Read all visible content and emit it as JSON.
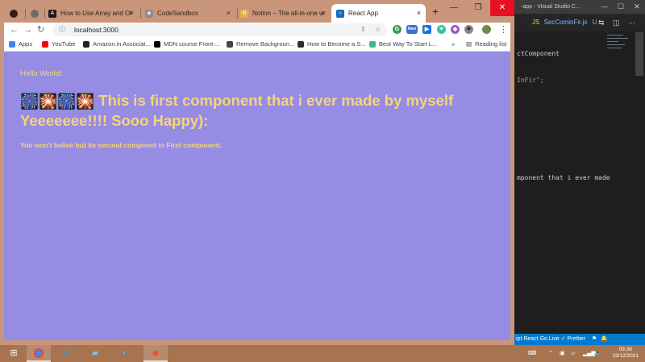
{
  "vscode": {
    "title": "-app - Visual Studio C...",
    "tab_file": "SecCominFir.js",
    "tab_status": "U",
    "code_lines": [
      "ctComponent",
      "InFir\";",
      "",
      "",
      "",
      "",
      "mponent that i ever made"
    ],
    "status_text": "ipt React   Go Live   ✓ Prettier"
  },
  "chrome": {
    "tabs": [
      {
        "label": "How to Use Array and Ol",
        "icon": "A",
        "color": "#1a1a1a"
      },
      {
        "label": "CodeSandbox",
        "icon": "◈",
        "color": "#6b6b6b"
      },
      {
        "label": "Notion – The all-in-one w",
        "icon": "N",
        "color": "#e0b24f"
      },
      {
        "label": "React App",
        "icon": "⚛",
        "color": "#1565c0"
      }
    ],
    "close_x": "×",
    "new_tab": "+",
    "url": "localhost:3000",
    "bookmarks": [
      {
        "label": "Apps",
        "color": "#4285f4"
      },
      {
        "label": "YouTube",
        "color": "#ff0000"
      },
      {
        "label": "Amazon.in Associat...",
        "color": "#222"
      },
      {
        "label": "MDN course Front-...",
        "color": "#000"
      },
      {
        "label": "Remove Backgroun...",
        "color": "#444"
      },
      {
        "label": "How to Become a S...",
        "color": "#2d2d2d"
      },
      {
        "label": "Best Way To Start L...",
        "color": "#41b883"
      }
    ],
    "more_bookmarks": "»",
    "reading_list": "Reading list",
    "extension_badge": "New"
  },
  "page": {
    "hello": "Hello World!",
    "emoji": "🎆🎇🎆🎇",
    "heading": "This is first component that i ever made by myself Yeeeeeee!!!! Sooo Happy):",
    "subheading": "You won't belive but its second compnent in First component."
  },
  "taskbar": {
    "time": "09:38",
    "date": "19/12/2021"
  },
  "colors": {
    "page_bg": "#978ce3",
    "text_yellow": "#f4d57b"
  }
}
